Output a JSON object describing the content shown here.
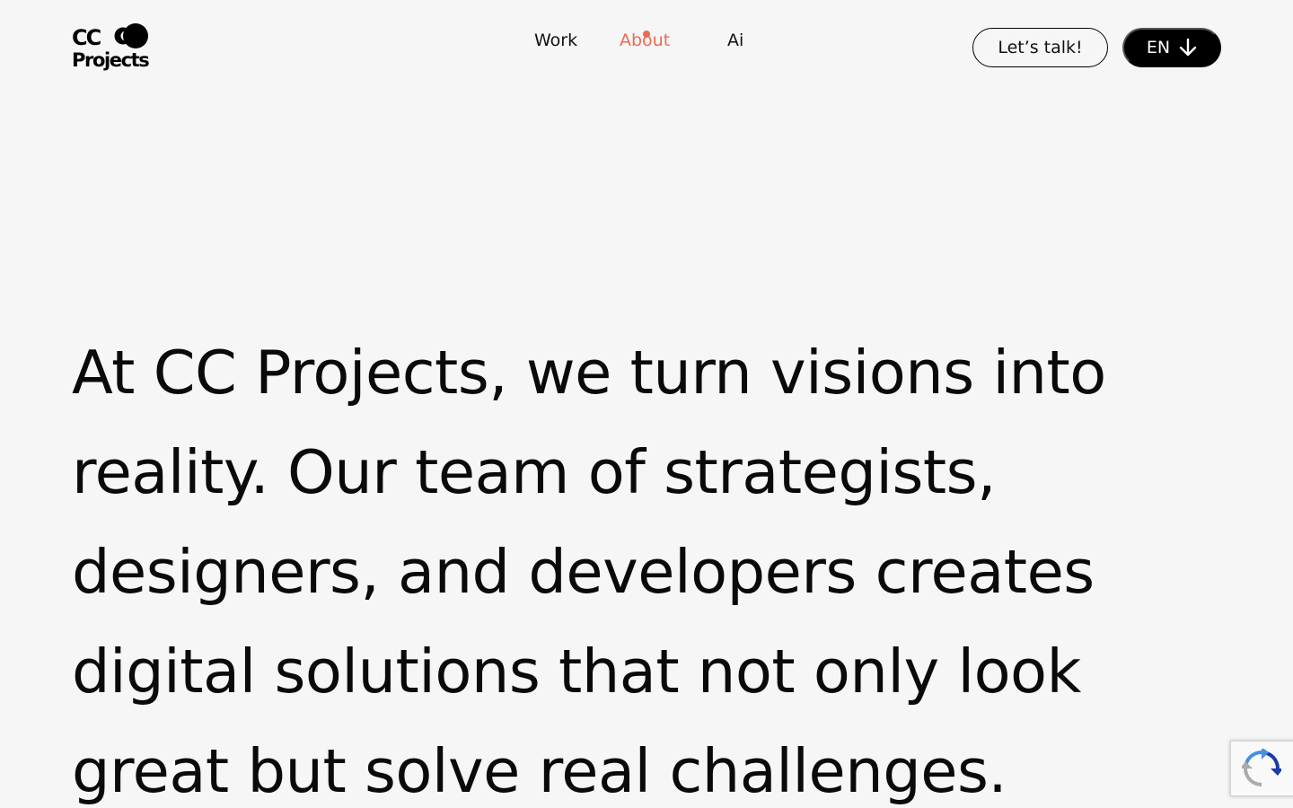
{
  "header": {
    "logo": {
      "line1": "CC",
      "line2": "Projects"
    },
    "nav": [
      {
        "label": "Work",
        "active": false
      },
      {
        "label": "About",
        "active": true
      },
      {
        "label": "Ai",
        "active": false
      }
    ],
    "cta_label": "Let’s talk!",
    "language_label": "EN",
    "accent_color": "#ee6a52"
  },
  "hero": {
    "lines": [
      "At CC Projects, we turn visions into",
      "reality. Our team of strategists,",
      "designers, and developers creates",
      "digital solutions that not only look",
      "great but solve real challenges."
    ]
  },
  "icons": {
    "language_arrow": "arrow-down-icon",
    "recaptcha": "recaptcha-icon"
  }
}
